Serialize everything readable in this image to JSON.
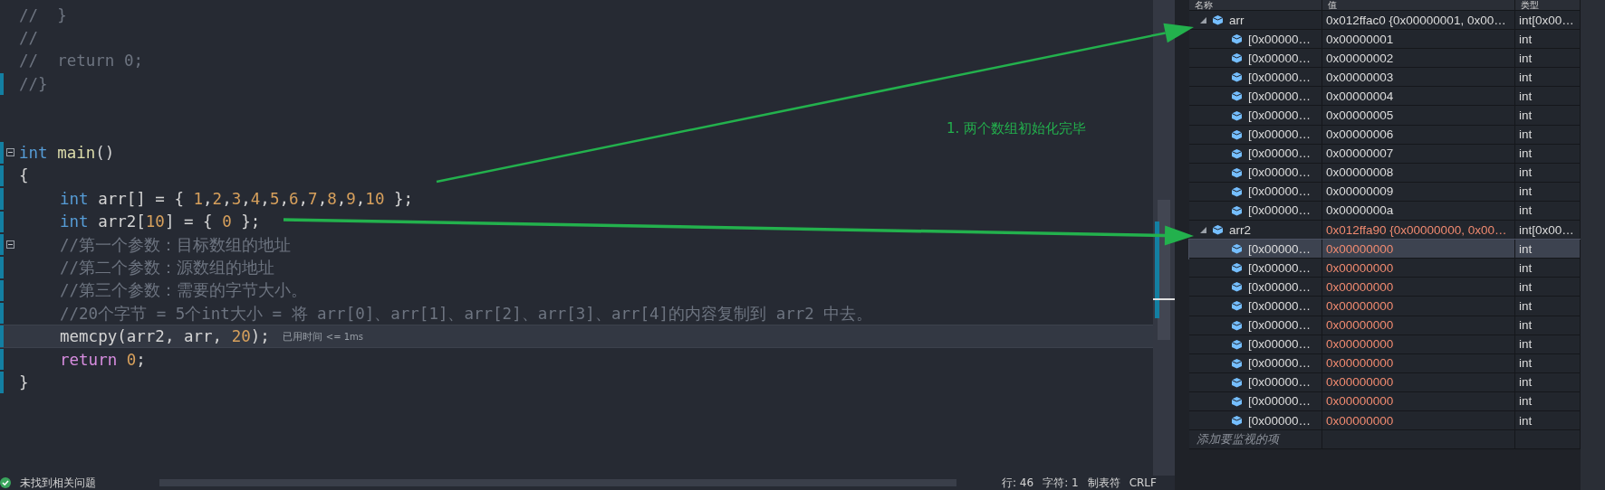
{
  "editor": {
    "lines": [
      {
        "kind": "code",
        "fold_toggle": false,
        "current": false,
        "indent": false,
        "segments": [
          {
            "text": "//  }",
            "kind": "comment"
          }
        ]
      },
      {
        "kind": "code",
        "fold_toggle": false,
        "current": false,
        "indent": false,
        "segments": [
          {
            "text": "//",
            "kind": "comment"
          }
        ]
      },
      {
        "kind": "code",
        "fold_toggle": false,
        "current": false,
        "indent": false,
        "segments": [
          {
            "text": "//  return 0;",
            "kind": "comment"
          }
        ]
      },
      {
        "kind": "code",
        "fold_toggle": false,
        "current": false,
        "indent": false,
        "segments": [
          {
            "text": "//}",
            "kind": "comment"
          }
        ]
      },
      {
        "kind": "blank"
      },
      {
        "kind": "blank"
      },
      {
        "kind": "code",
        "fold_toggle": true,
        "current": false,
        "indent": false,
        "segments": [
          {
            "text": "int",
            "kind": "keyword"
          },
          {
            "text": " main",
            "kind": "function"
          },
          {
            "text": "()",
            "kind": "plain"
          }
        ]
      },
      {
        "kind": "code",
        "fold_toggle": false,
        "current": false,
        "indent": false,
        "segments": [
          {
            "text": "{",
            "kind": "plain"
          }
        ]
      },
      {
        "kind": "code",
        "fold_toggle": false,
        "current": false,
        "indent": true,
        "segments": [
          {
            "text": "int",
            "kind": "keyword"
          },
          {
            "text": " arr[] = { ",
            "kind": "plain"
          },
          {
            "text": "1",
            "kind": "number"
          },
          {
            "text": ",",
            "kind": "plain"
          },
          {
            "text": "2",
            "kind": "number"
          },
          {
            "text": ",",
            "kind": "plain"
          },
          {
            "text": "3",
            "kind": "number"
          },
          {
            "text": ",",
            "kind": "plain"
          },
          {
            "text": "4",
            "kind": "number"
          },
          {
            "text": ",",
            "kind": "plain"
          },
          {
            "text": "5",
            "kind": "number"
          },
          {
            "text": ",",
            "kind": "plain"
          },
          {
            "text": "6",
            "kind": "number"
          },
          {
            "text": ",",
            "kind": "plain"
          },
          {
            "text": "7",
            "kind": "number"
          },
          {
            "text": ",",
            "kind": "plain"
          },
          {
            "text": "8",
            "kind": "number"
          },
          {
            "text": ",",
            "kind": "plain"
          },
          {
            "text": "9",
            "kind": "number"
          },
          {
            "text": ",",
            "kind": "plain"
          },
          {
            "text": "10",
            "kind": "number"
          },
          {
            "text": " };",
            "kind": "plain"
          }
        ]
      },
      {
        "kind": "code",
        "fold_toggle": false,
        "current": false,
        "indent": true,
        "segments": [
          {
            "text": "int",
            "kind": "keyword"
          },
          {
            "text": " arr2[",
            "kind": "plain"
          },
          {
            "text": "10",
            "kind": "number"
          },
          {
            "text": "] = { ",
            "kind": "plain"
          },
          {
            "text": "0",
            "kind": "number"
          },
          {
            "text": " };",
            "kind": "plain"
          }
        ]
      },
      {
        "kind": "code",
        "fold_toggle": true,
        "current": false,
        "indent": true,
        "segments": [
          {
            "text": "//第一个参数：目标数组的地址",
            "kind": "comment"
          }
        ]
      },
      {
        "kind": "code",
        "fold_toggle": false,
        "current": false,
        "indent": true,
        "segments": [
          {
            "text": "//第二个参数：源数组的地址",
            "kind": "comment"
          }
        ]
      },
      {
        "kind": "code",
        "fold_toggle": false,
        "current": false,
        "indent": true,
        "segments": [
          {
            "text": "//第三个参数：需要的字节大小。",
            "kind": "comment"
          }
        ]
      },
      {
        "kind": "code",
        "fold_toggle": false,
        "current": false,
        "indent": true,
        "segments": [
          {
            "text": "//20个字节 = 5个int大小 = 将 arr[0]、arr[1]、arr[2]、arr[3]、arr[4]的内容复制到 arr2 中去。",
            "kind": "comment"
          }
        ]
      },
      {
        "kind": "code",
        "fold_toggle": false,
        "current": true,
        "indent": true,
        "hint": "已用时间",
        "hint_value": "<= 1ms",
        "segments": [
          {
            "text": "memcpy(arr2, arr, ",
            "kind": "plain"
          },
          {
            "text": "20",
            "kind": "number"
          },
          {
            "text": ");",
            "kind": "plain"
          }
        ]
      },
      {
        "kind": "code",
        "fold_toggle": false,
        "current": false,
        "indent": true,
        "segments": [
          {
            "text": "return",
            "kind": "control"
          },
          {
            "text": " 0",
            "kind": "number"
          },
          {
            "text": ";",
            "kind": "plain"
          }
        ]
      },
      {
        "kind": "code",
        "fold_toggle": false,
        "current": false,
        "indent": false,
        "segments": [
          {
            "text": "}",
            "kind": "plain"
          }
        ]
      }
    ]
  },
  "annotation": "1. 两个数组初始化完毕",
  "status_bar": {
    "message": "未找到相关问题",
    "line": "行: 46",
    "char": "字符: 1",
    "indent": "制表符",
    "eol": "CRLF"
  },
  "watch": {
    "columns": [
      "名称",
      "值",
      "类型"
    ],
    "rows": [
      {
        "name": "arr",
        "value": "0x012ffac0 {0x00000001, 0x00…",
        "type": "int[0x00…",
        "expanded": true,
        "changed": false,
        "selected": false,
        "children": [
          {
            "name": "[0x00000…",
            "value": "0x00000001",
            "type": "int",
            "changed": false,
            "selected": false
          },
          {
            "name": "[0x00000…",
            "value": "0x00000002",
            "type": "int",
            "changed": false,
            "selected": false
          },
          {
            "name": "[0x00000…",
            "value": "0x00000003",
            "type": "int",
            "changed": false,
            "selected": false
          },
          {
            "name": "[0x00000…",
            "value": "0x00000004",
            "type": "int",
            "changed": false,
            "selected": false
          },
          {
            "name": "[0x00000…",
            "value": "0x00000005",
            "type": "int",
            "changed": false,
            "selected": false
          },
          {
            "name": "[0x00000…",
            "value": "0x00000006",
            "type": "int",
            "changed": false,
            "selected": false
          },
          {
            "name": "[0x00000…",
            "value": "0x00000007",
            "type": "int",
            "changed": false,
            "selected": false
          },
          {
            "name": "[0x00000…",
            "value": "0x00000008",
            "type": "int",
            "changed": false,
            "selected": false
          },
          {
            "name": "[0x00000…",
            "value": "0x00000009",
            "type": "int",
            "changed": false,
            "selected": false
          },
          {
            "name": "[0x00000…",
            "value": "0x0000000a",
            "type": "int",
            "changed": false,
            "selected": false
          }
        ]
      },
      {
        "name": "arr2",
        "value": "0x012ffa90 {0x00000000, 0x00…",
        "type": "int[0x00…",
        "expanded": true,
        "changed": true,
        "selected": false,
        "children": [
          {
            "name": "[0x00000…",
            "value": "0x00000000",
            "type": "int",
            "changed": true,
            "selected": true
          },
          {
            "name": "[0x00000…",
            "value": "0x00000000",
            "type": "int",
            "changed": true,
            "selected": false
          },
          {
            "name": "[0x00000…",
            "value": "0x00000000",
            "type": "int",
            "changed": true,
            "selected": false
          },
          {
            "name": "[0x00000…",
            "value": "0x00000000",
            "type": "int",
            "changed": true,
            "selected": false
          },
          {
            "name": "[0x00000…",
            "value": "0x00000000",
            "type": "int",
            "changed": true,
            "selected": false
          },
          {
            "name": "[0x00000…",
            "value": "0x00000000",
            "type": "int",
            "changed": true,
            "selected": false
          },
          {
            "name": "[0x00000…",
            "value": "0x00000000",
            "type": "int",
            "changed": true,
            "selected": false
          },
          {
            "name": "[0x00000…",
            "value": "0x00000000",
            "type": "int",
            "changed": true,
            "selected": false
          },
          {
            "name": "[0x00000…",
            "value": "0x00000000",
            "type": "int",
            "changed": true,
            "selected": false
          },
          {
            "name": "[0x00000…",
            "value": "0x00000000",
            "type": "int",
            "changed": true,
            "selected": false
          }
        ]
      }
    ],
    "add_placeholder": "添加要监视的项"
  }
}
